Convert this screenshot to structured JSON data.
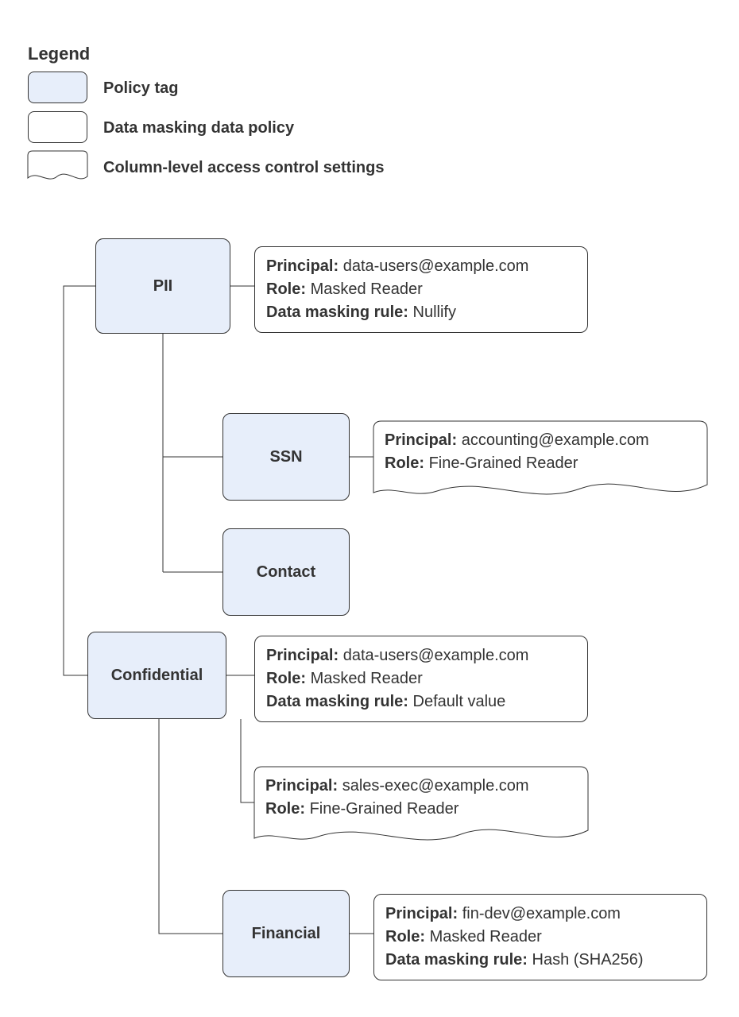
{
  "legend": {
    "title": "Legend",
    "items": {
      "policy_tag": "Policy tag",
      "data_policy": "Data masking data policy",
      "column_level": "Column-level access control settings"
    }
  },
  "labels": {
    "principal": "Principal:",
    "role": "Role:",
    "rule": "Data masking rule:"
  },
  "nodes": {
    "pii": {
      "tag": "PII",
      "policy": {
        "principal": "data-users@example.com",
        "role": "Masked Reader",
        "rule": "Nullify"
      },
      "children": {
        "ssn": {
          "tag": "SSN",
          "access": {
            "principal": "accounting@example.com",
            "role": "Fine-Grained Reader"
          }
        },
        "contact": {
          "tag": "Contact"
        }
      }
    },
    "confidential": {
      "tag": "Confidential",
      "policy": {
        "principal": "data-users@example.com",
        "role": "Masked Reader",
        "rule": "Default value"
      },
      "access": {
        "principal": "sales-exec@example.com",
        "role": "Fine-Grained Reader"
      },
      "children": {
        "financial": {
          "tag": "Financial",
          "policy": {
            "principal": "fin-dev@example.com",
            "role": "Masked Reader",
            "rule": "Hash (SHA256)"
          }
        }
      }
    }
  }
}
